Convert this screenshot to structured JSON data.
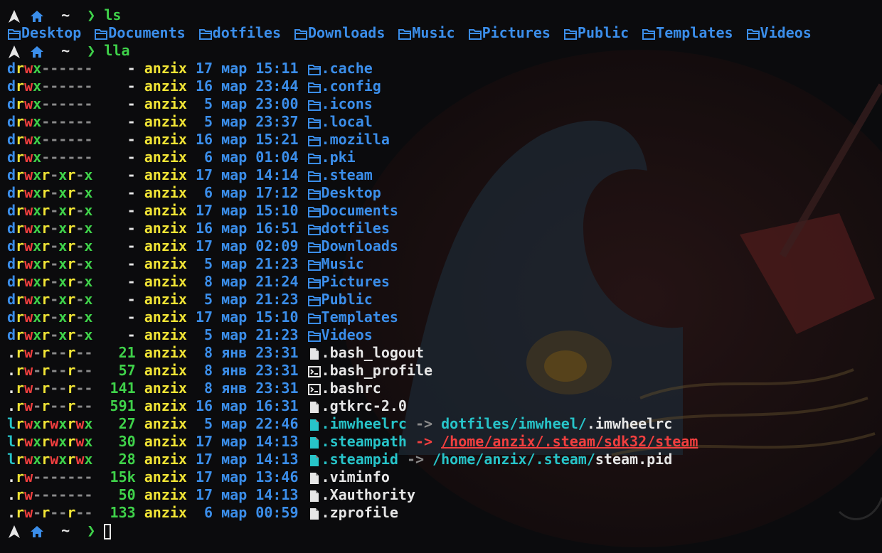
{
  "prompt": {
    "symbol": "❯",
    "path": "~"
  },
  "commands": [
    "ls",
    "lla"
  ],
  "ls_items": [
    "Desktop",
    "Documents",
    "dotfiles",
    "Downloads",
    "Music",
    "Pictures",
    "Public",
    "Templates",
    "Videos"
  ],
  "listing": [
    {
      "perm": "drwx------",
      "size": "-",
      "user": "anzix",
      "day": "17",
      "month": "мар",
      "time": "15:11",
      "type": "dir",
      "name": ".cache"
    },
    {
      "perm": "drwx------",
      "size": "-",
      "user": "anzix",
      "day": "16",
      "month": "мар",
      "time": "23:44",
      "type": "dir",
      "name": ".config"
    },
    {
      "perm": "drwx------",
      "size": "-",
      "user": "anzix",
      "day": "5",
      "month": "мар",
      "time": "23:00",
      "type": "dir",
      "name": ".icons"
    },
    {
      "perm": "drwx------",
      "size": "-",
      "user": "anzix",
      "day": "5",
      "month": "мар",
      "time": "23:37",
      "type": "dir",
      "name": ".local"
    },
    {
      "perm": "drwx------",
      "size": "-",
      "user": "anzix",
      "day": "16",
      "month": "мар",
      "time": "15:21",
      "type": "dir",
      "name": ".mozilla"
    },
    {
      "perm": "drwx------",
      "size": "-",
      "user": "anzix",
      "day": "6",
      "month": "мар",
      "time": "01:04",
      "type": "dir",
      "name": ".pki"
    },
    {
      "perm": "drwxr-xr-x",
      "size": "-",
      "user": "anzix",
      "day": "17",
      "month": "мар",
      "time": "14:14",
      "type": "dir",
      "name": ".steam"
    },
    {
      "perm": "drwxr-xr-x",
      "size": "-",
      "user": "anzix",
      "day": "6",
      "month": "мар",
      "time": "17:12",
      "type": "dir",
      "name": "Desktop"
    },
    {
      "perm": "drwxr-xr-x",
      "size": "-",
      "user": "anzix",
      "day": "17",
      "month": "мар",
      "time": "15:10",
      "type": "dir",
      "name": "Documents"
    },
    {
      "perm": "drwxr-xr-x",
      "size": "-",
      "user": "anzix",
      "day": "16",
      "month": "мар",
      "time": "16:51",
      "type": "dir",
      "name": "dotfiles"
    },
    {
      "perm": "drwxr-xr-x",
      "size": "-",
      "user": "anzix",
      "day": "17",
      "month": "мар",
      "time": "02:09",
      "type": "dir",
      "name": "Downloads"
    },
    {
      "perm": "drwxr-xr-x",
      "size": "-",
      "user": "anzix",
      "day": "5",
      "month": "мар",
      "time": "21:23",
      "type": "dir",
      "name": "Music"
    },
    {
      "perm": "drwxr-xr-x",
      "size": "-",
      "user": "anzix",
      "day": "8",
      "month": "мар",
      "time": "21:24",
      "type": "dir",
      "name": "Pictures"
    },
    {
      "perm": "drwxr-xr-x",
      "size": "-",
      "user": "anzix",
      "day": "5",
      "month": "мар",
      "time": "21:23",
      "type": "dir",
      "name": "Public"
    },
    {
      "perm": "drwxr-xr-x",
      "size": "-",
      "user": "anzix",
      "day": "17",
      "month": "мар",
      "time": "15:10",
      "type": "dir",
      "name": "Templates"
    },
    {
      "perm": "drwxr-xr-x",
      "size": "-",
      "user": "anzix",
      "day": "5",
      "month": "мар",
      "time": "21:23",
      "type": "dir",
      "name": "Videos"
    },
    {
      "perm": ".rw-r--r--",
      "size": "21",
      "user": "anzix",
      "day": "8",
      "month": "янв",
      "time": "23:31",
      "type": "file",
      "name": ".bash_logout"
    },
    {
      "perm": ".rw-r--r--",
      "size": "57",
      "user": "anzix",
      "day": "8",
      "month": "янв",
      "time": "23:31",
      "type": "script",
      "name": ".bash_profile"
    },
    {
      "perm": ".rw-r--r--",
      "size": "141",
      "user": "anzix",
      "day": "8",
      "month": "янв",
      "time": "23:31",
      "type": "script",
      "name": ".bashrc"
    },
    {
      "perm": ".rw-r--r--",
      "size": "591",
      "user": "anzix",
      "day": "16",
      "month": "мар",
      "time": "16:31",
      "type": "file",
      "name": ".gtkrc-2.0"
    },
    {
      "perm": "lrwxrwxrwx",
      "size": "27",
      "user": "anzix",
      "day": "5",
      "month": "мар",
      "time": "22:46",
      "type": "link",
      "name": ".imwheelrc",
      "arrow": "->",
      "target_dir": "dotfiles/imwheel/",
      "target_file": ".imwheelrc",
      "broken": false
    },
    {
      "perm": "lrwxrwxrwx",
      "size": "30",
      "user": "anzix",
      "day": "17",
      "month": "мар",
      "time": "14:13",
      "type": "link",
      "name": ".steampath",
      "arrow": "->",
      "target_dir": "/home/anzix/.steam/sdk32/steam",
      "target_file": "",
      "broken": true
    },
    {
      "perm": "lrwxrwxrwx",
      "size": "28",
      "user": "anzix",
      "day": "17",
      "month": "мар",
      "time": "14:13",
      "type": "link",
      "name": ".steampid",
      "arrow": "->",
      "target_dir": "/home/anzix/.steam/",
      "target_file": "steam.pid",
      "broken": false
    },
    {
      "perm": ".rw-------",
      "size": "15k",
      "user": "anzix",
      "day": "17",
      "month": "мар",
      "time": "13:46",
      "type": "file",
      "name": ".viminfo"
    },
    {
      "perm": ".rw-------",
      "size": "50",
      "user": "anzix",
      "day": "17",
      "month": "мар",
      "time": "14:13",
      "type": "file",
      "name": ".Xauthority"
    },
    {
      "perm": ".rw-r--r--",
      "size": "133",
      "user": "anzix",
      "day": "6",
      "month": "мар",
      "time": "00:59",
      "type": "file",
      "name": ".zprofile"
    }
  ],
  "colors": {
    "background": "#0b0b0d",
    "dir": "#3b8eea",
    "read": "#f1e435",
    "write": "#f23f3f",
    "exec": "#3fd24a",
    "user": "#f1e435",
    "link": "#27c4c9",
    "broken": "#f23f3f",
    "text": "#e6e6e6"
  },
  "icons": {
    "prompt-logo": "arch-icon",
    "home": "home-icon",
    "folder": "folder-icon",
    "file": "file-icon",
    "script": "terminal-icon"
  }
}
